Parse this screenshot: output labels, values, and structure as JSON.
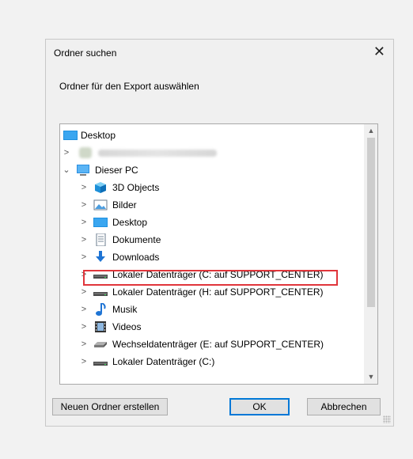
{
  "dialog": {
    "title": "Ordner suchen",
    "close_symbol": "✕",
    "instruction": "Ordner für den Export auswählen"
  },
  "tree": {
    "root": "Desktop",
    "user_blurred": "",
    "this_pc": "Dieser PC",
    "items": [
      {
        "label": "3D Objects",
        "icon": "3d-objects-icon"
      },
      {
        "label": "Bilder",
        "icon": "pictures-icon"
      },
      {
        "label": "Desktop",
        "icon": "desktop-icon"
      },
      {
        "label": "Dokumente",
        "icon": "documents-icon"
      },
      {
        "label": "Downloads",
        "icon": "downloads-icon"
      },
      {
        "label": "Lokaler Datenträger (C: auf SUPPORT_CENTER)",
        "icon": "drive-icon",
        "selected": true
      },
      {
        "label": "Lokaler Datenträger (H: auf SUPPORT_CENTER)",
        "icon": "drive-icon"
      },
      {
        "label": "Musik",
        "icon": "music-icon"
      },
      {
        "label": "Videos",
        "icon": "videos-icon"
      },
      {
        "label": "Wechseldatenträger (E: auf SUPPORT_CENTER)",
        "icon": "removable-drive-icon"
      },
      {
        "label": "Lokaler Datenträger (C:)",
        "icon": "drive-icon"
      }
    ],
    "highlight_color": "#e0353b"
  },
  "buttons": {
    "new_folder": "Neuen Ordner erstellen",
    "ok": "OK",
    "cancel": "Abbrechen"
  },
  "colors": {
    "accent": "#0078d7"
  }
}
